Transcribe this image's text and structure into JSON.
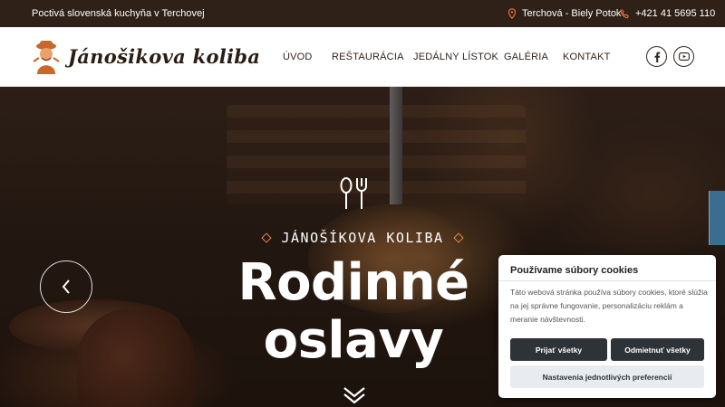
{
  "topbar": {
    "tagline": "Poctivá slovenská kuchyňa v Terchovej",
    "location": "Terchová - Biely Potok",
    "phone": "+421 41 5695 110",
    "accent_color": "#e0723a"
  },
  "header": {
    "logo_text": "Jánošikova koliba",
    "nav": [
      "ÚVOD",
      "REŠTAURÁCIA",
      "JEDÁLNY LÍSTOK",
      "GALÉRIA",
      "KONTAKT"
    ],
    "social": [
      "facebook-icon",
      "youtube-icon"
    ]
  },
  "hero": {
    "eyebrow": "JÁNOŠÍKOVA KOLIBA",
    "headline_line1": "Rodinné",
    "headline_line2": "oslavy",
    "accent_color": "#e0894a"
  },
  "cookie": {
    "title": "Používame súbory cookies",
    "text": "Táto webová stránka používa súbory cookies, ktoré slúžia na jej správne fungovanie, personalizáciu reklám a meranie návštevnosti.",
    "accept_label": "Prijať všetky",
    "reject_label": "Odmietnuť všetky",
    "prefs_label": "Nastavenia jednotlivých preferencií"
  }
}
